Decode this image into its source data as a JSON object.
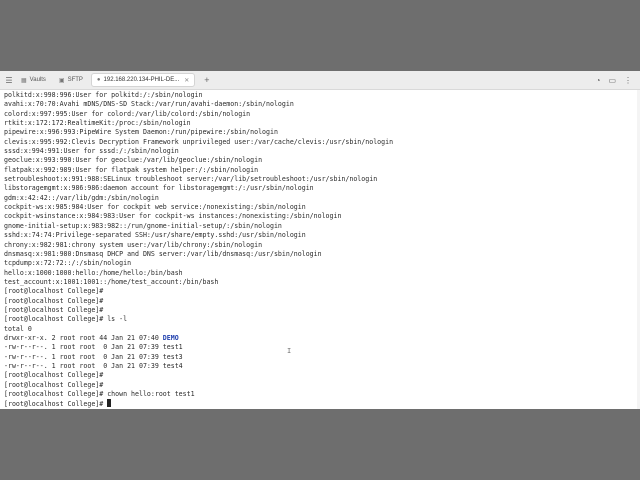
{
  "tabs": [
    {
      "label": "Vaults",
      "icon": "▦",
      "active": false
    },
    {
      "label": "SFTP",
      "icon": "▣",
      "active": false
    },
    {
      "label": "192.168.220.134-PHIL-DE...",
      "icon": "●",
      "active": true
    }
  ],
  "icons": {
    "menu": "☰",
    "add_tab": "+",
    "close_tab": "✕",
    "bell": "◔",
    "split": "▭",
    "more": "⋮",
    "ibeam": "I"
  },
  "terminal": {
    "lines": [
      "polkitd:x:998:996:User for polkitd:/:/sbin/nologin",
      "avahi:x:70:70:Avahi mDNS/DNS-SD Stack:/var/run/avahi-daemon:/sbin/nologin",
      "colord:x:997:995:User for colord:/var/lib/colord:/sbin/nologin",
      "rtkit:x:172:172:RealtimeKit:/proc:/sbin/nologin",
      "pipewire:x:996:993:PipeWire System Daemon:/run/pipewire:/sbin/nologin",
      "clevis:x:995:992:Clevis Decryption Framework unprivileged user:/var/cache/clevis:/usr/sbin/nologin",
      "sssd:x:994:991:User for sssd:/:/sbin/nologin",
      "geoclue:x:993:990:User for geoclue:/var/lib/geoclue:/sbin/nologin",
      "flatpak:x:992:989:User for flatpak system helper:/:/sbin/nologin",
      "setroubleshoot:x:991:988:SELinux troubleshoot server:/var/lib/setroubleshoot:/usr/sbin/nologin",
      "libstoragemgmt:x:986:986:daemon account for libstoragemgmt:/:/usr/sbin/nologin",
      "gdm:x:42:42::/var/lib/gdm:/sbin/nologin",
      "cockpit-ws:x:985:984:User for cockpit web service:/nonexisting:/sbin/nologin",
      "cockpit-wsinstance:x:984:983:User for cockpit-ws instances:/nonexisting:/sbin/nologin",
      "gnome-initial-setup:x:983:982::/run/gnome-initial-setup/:/sbin/nologin",
      "sshd:x:74:74:Privilege-separated SSH:/usr/share/empty.sshd:/usr/sbin/nologin",
      "chrony:x:982:981:chrony system user:/var/lib/chrony:/sbin/nologin",
      "dnsmasq:x:981:980:Dnsmasq DHCP and DNS server:/var/lib/dnsmasq:/usr/sbin/nologin",
      "tcpdump:x:72:72::/:/sbin/nologin",
      "hello:x:1000:1000:hello:/home/hello:/bin/bash",
      "test_account:x:1001:1001::/home/test_account:/bin/bash",
      "[root@localhost College]#",
      "[root@localhost College]#",
      "[root@localhost College]#",
      "[root@localhost College]# ls -l",
      "total 0"
    ],
    "dir_line_prefix": "drwxr-xr-x. 2 root root 44 Jan 21 07:40 ",
    "dir_name": "DEMO",
    "lines_after": [
      "-rw-r--r--. 1 root root  0 Jan 21 07:39 test1",
      "-rw-r--r--. 1 root root  0 Jan 21 07:39 test3",
      "-rw-r--r--. 1 root root  0 Jan 21 07:39 test4",
      "[root@localhost College]#",
      "[root@localhost College]#",
      "[root@localhost College]# chown hello:root test1"
    ],
    "prompt_final": "[root@localhost College]# "
  }
}
